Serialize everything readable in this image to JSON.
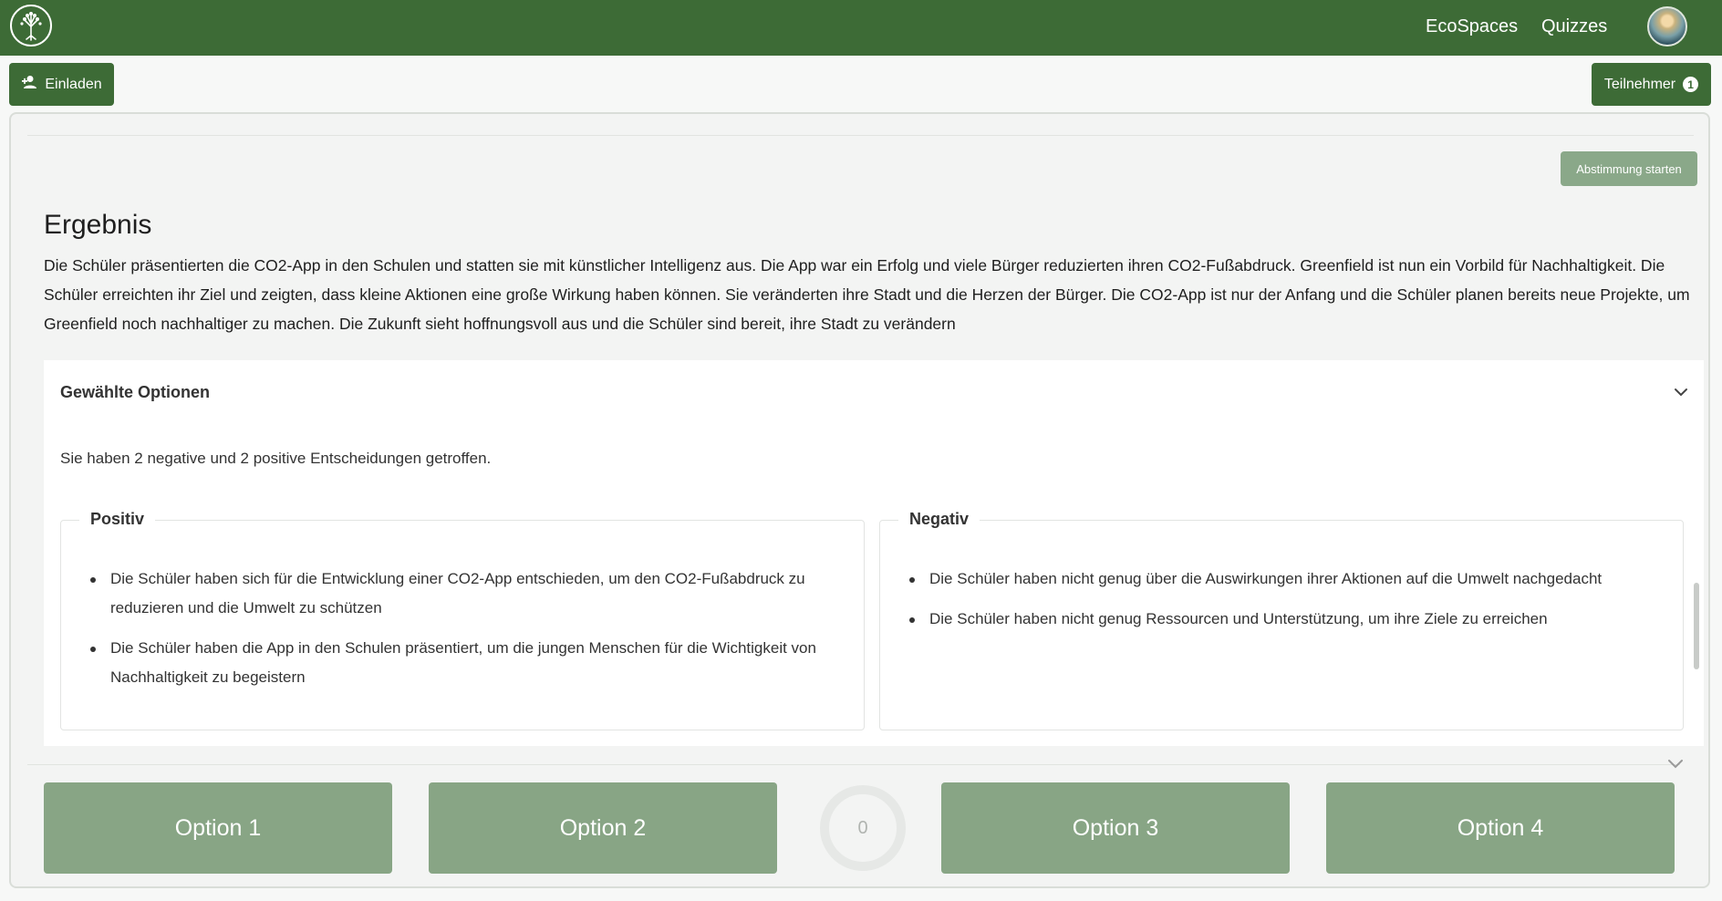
{
  "nav": {
    "links": [
      "EcoSpaces",
      "Quizzes"
    ]
  },
  "toolbar": {
    "invite_label": "Einladen",
    "participants_label": "Teilnehmer",
    "participants_count": "1"
  },
  "main": {
    "vote_button": "Abstimmung starten",
    "result_title": "Ergebnis",
    "result_text": "Die Schüler präsentierten die CO2-App in den Schulen und statten sie mit künstlicher Intelligenz aus. Die App war ein Erfolg und viele Bürger reduzierten ihren CO2-Fußabdruck. Greenfield ist nun ein Vorbild für Nachhaltigkeit. Die Schüler erreichten ihr Ziel und zeigten, dass kleine Aktionen eine große Wirkung haben können. Sie veränderten ihre Stadt und die Herzen der Bürger. Die CO2-App ist nur der Anfang und die Schüler planen bereits neue Projekte, um Greenfield noch nachhaltiger zu machen. Die Zukunft sieht hoffnungsvoll aus und die Schüler sind bereit, ihre Stadt zu verändern",
    "accordion": {
      "title": "Gewählte Optionen",
      "summary": "Sie haben 2 negative und 2 positive Entscheidungen getroffen.",
      "positive": {
        "legend": "Positiv",
        "items": [
          "Die Schüler haben sich für die Entwicklung einer CO2-App entschieden, um den CO2-Fußabdruck zu reduzieren und die Umwelt zu schützen",
          "Die Schüler haben die App in den Schulen präsentiert, um die jungen Menschen für die Wichtigkeit von Nachhaltigkeit zu begeistern"
        ]
      },
      "negative": {
        "legend": "Negativ",
        "items": [
          "Die Schüler haben nicht genug über die Auswirkungen ihrer Aktionen auf die Umwelt nachgedacht",
          "Die Schüler haben nicht genug Ressourcen und Unterstützung, um ihre Ziele zu erreichen"
        ]
      }
    }
  },
  "options": [
    "Option 1",
    "Option 2",
    "Option 3",
    "Option 4"
  ],
  "timer": {
    "value": "0"
  },
  "colors": {
    "primary": "#3d6b36",
    "option": "#88a585",
    "vote_button": "#8aa889"
  }
}
